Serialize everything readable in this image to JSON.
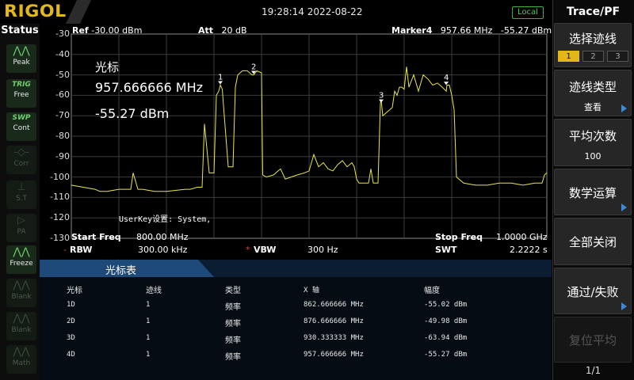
{
  "brand": "RIGOL",
  "datetime": "19:28:14 2022-08-22",
  "remote_status": "Local",
  "status_panel": {
    "title": "Status",
    "buttons": [
      {
        "label": "Peak",
        "icon": "peak-icon",
        "active": true
      },
      {
        "label": "TRIG",
        "label2": "Free",
        "icon": "trig-icon",
        "active": true
      },
      {
        "label": "SWP",
        "label2": "Cont",
        "icon": "sweep-icon",
        "active": true
      },
      {
        "label": "Corr",
        "icon": "corr-icon",
        "active": false
      },
      {
        "label": "S.T",
        "icon": "st-icon",
        "active": false
      },
      {
        "label": "PA",
        "icon": "pa-icon",
        "active": false
      },
      {
        "label": "Freeze",
        "icon": "freeze-icon",
        "active": true
      },
      {
        "label": "Blank",
        "icon": "blank-icon",
        "active": false
      },
      {
        "label": "Blank",
        "icon": "blank-icon",
        "active": false
      },
      {
        "label": "Math",
        "icon": "math-icon",
        "active": false
      }
    ]
  },
  "header": {
    "ref_label": "Ref",
    "ref_value": "-30.00 dBm",
    "att_label": "Att",
    "att_value": "20 dB",
    "marker_label": "Marker4",
    "marker_freq": "957.66 MHz",
    "marker_amp": "-55.27 dBm"
  },
  "marker_readout": {
    "title": "光标",
    "freq": "957.666666 MHz",
    "amp": "-55.27 dBm"
  },
  "user_key_text": "UserKey设置:   System,",
  "chart_data": {
    "type": "line",
    "xlabel": "",
    "ylabel": "",
    "xlim": [
      800.0,
      1000.0
    ],
    "ylim": [
      -130,
      -30
    ],
    "ytick_labels": [
      "-30",
      "-40",
      "-50",
      "-60",
      "-70",
      "-80",
      "-90",
      "-100",
      "-110",
      "-120",
      "-130"
    ],
    "grid": true,
    "trace_color": "#e8e84a",
    "trace": {
      "x": [
        800,
        805,
        810,
        812,
        815,
        820,
        825,
        826,
        828,
        830,
        835,
        840,
        848,
        850,
        853,
        855,
        856,
        858,
        860,
        861,
        862,
        862.7,
        863.5,
        864,
        866,
        868,
        869,
        870,
        872,
        874,
        876,
        876.7,
        878,
        880,
        880.5,
        882,
        885,
        888,
        890,
        895,
        898,
        900,
        901,
        902,
        904,
        906,
        908,
        910,
        912,
        914,
        916,
        918,
        919,
        920,
        921,
        923,
        925,
        926,
        927,
        928,
        929,
        930,
        930.3,
        931,
        933,
        935,
        936,
        937,
        938,
        939,
        940,
        941,
        942,
        944,
        946,
        948,
        950,
        952,
        954,
        956,
        957.7,
        958,
        959,
        960,
        961,
        962,
        965,
        970,
        975,
        980,
        985,
        990,
        995,
        998,
        999,
        1000
      ],
      "y": [
        -104,
        -105,
        -106,
        -107,
        -107,
        -106,
        -106,
        -98,
        -106,
        -106,
        -107,
        -107,
        -106,
        -106,
        -105,
        -105,
        -74,
        -98,
        -98,
        -60,
        -58,
        -55,
        -57,
        -65,
        -95,
        -95,
        -56,
        -50,
        -48,
        -48,
        -50,
        -50,
        -48,
        -49,
        -99,
        -100,
        -99,
        -96,
        -101,
        -99,
        -98,
        -97,
        -93,
        -89,
        -95,
        -93,
        -96,
        -97,
        -94,
        -92,
        -95,
        -93,
        -95,
        -101,
        -103,
        -103,
        -103,
        -96,
        -103,
        -103,
        -103,
        -64,
        -62,
        -70,
        -68,
        -66,
        -58,
        -60,
        -56,
        -56,
        -57,
        -46,
        -56,
        -50,
        -58,
        -50,
        -52,
        -55,
        -54,
        -56,
        -58,
        -55,
        -55,
        -60,
        -67,
        -100,
        -103,
        -104,
        -104,
        -103,
        -103,
        -104,
        -103,
        -103,
        -99,
        -98
      ],
      "markers": [
        {
          "id": "1",
          "x": 862.666666,
          "y": -55.02
        },
        {
          "id": "2",
          "x": 876.666666,
          "y": -49.98
        },
        {
          "id": "3",
          "x": 930.333333,
          "y": -63.94
        },
        {
          "id": "4",
          "x": 957.666666,
          "y": -55.27
        }
      ]
    }
  },
  "footer": {
    "start_label": "Start Freq",
    "start_value": "800.00 MHz",
    "stop_label": "Stop Freq",
    "stop_value": "1.0000 GHz",
    "rbw_label": "RBW",
    "rbw_value": "300.00 kHz",
    "vbw_label": "VBW",
    "vbw_value": "300 Hz",
    "swt_label": "SWT",
    "swt_value": "2.2222 s"
  },
  "marker_table": {
    "title": "光标表",
    "headers": [
      "光标",
      "迹线",
      "类型",
      "X 轴",
      "幅度"
    ],
    "rows": [
      [
        "1D",
        "1",
        "频率",
        "862.666666 MHz",
        "-55.02 dBm"
      ],
      [
        "2D",
        "1",
        "频率",
        "876.666666 MHz",
        "-49.98 dBm"
      ],
      [
        "3D",
        "1",
        "频率",
        "930.333333 MHz",
        "-63.94 dBm"
      ],
      [
        "4D",
        "1",
        "频率",
        "957.666666 MHz",
        "-55.27 dBm"
      ]
    ]
  },
  "right_menu": {
    "title": "Trace/PF",
    "select_trace": {
      "label": "选择迹线",
      "options": [
        "1",
        "2",
        "3"
      ],
      "selected": "1"
    },
    "trace_type": {
      "label": "迹线类型",
      "value": "查看"
    },
    "avg_count": {
      "label": "平均次数",
      "value": "100"
    },
    "math_op": {
      "label": "数学运算"
    },
    "all_off": {
      "label": "全部关闭"
    },
    "pass_fail": {
      "label": "通过/失败"
    },
    "reset_avg": {
      "label": "复位平均"
    },
    "page": "1/1"
  }
}
